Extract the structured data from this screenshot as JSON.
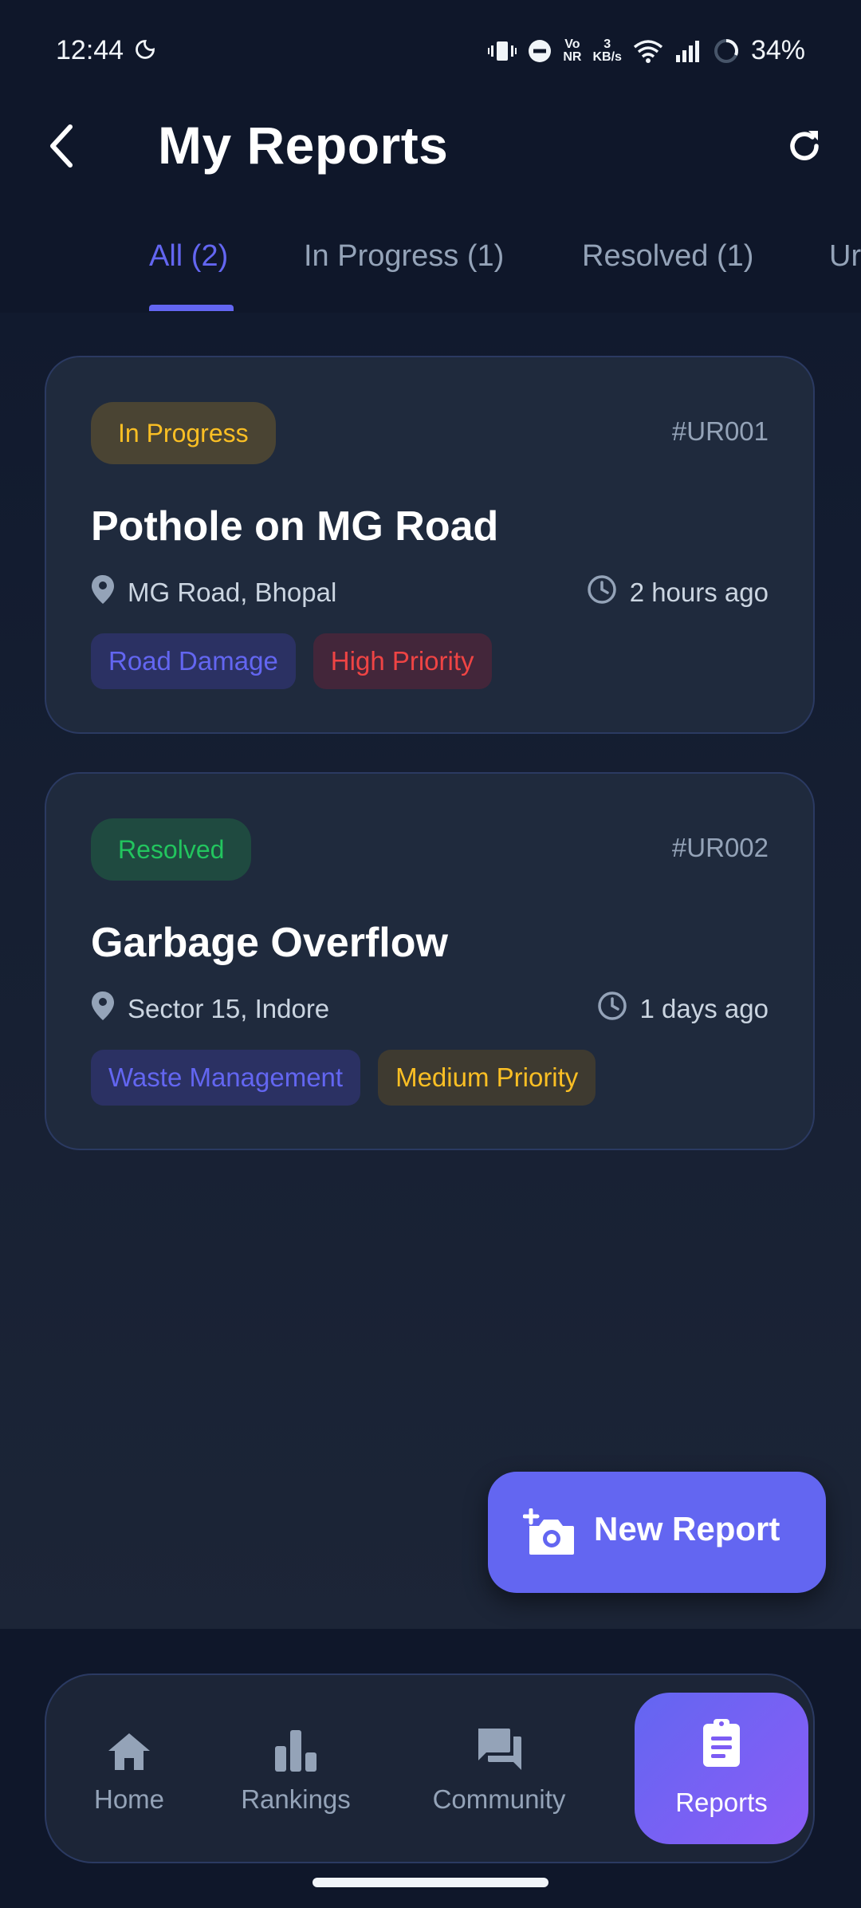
{
  "status_bar": {
    "time": "12:44",
    "net_top": "Vo",
    "net_bottom": "NR",
    "speed_top": "3",
    "speed_bottom": "KB/s",
    "battery": "34%"
  },
  "app_bar": {
    "title": "My Reports"
  },
  "tabs": [
    {
      "label": "All (2)",
      "active": true
    },
    {
      "label": "In Progress (1)",
      "active": false
    },
    {
      "label": "Resolved (1)",
      "active": false
    },
    {
      "label": "Ur",
      "active": false
    }
  ],
  "reports": [
    {
      "status": "In Progress",
      "id": "#UR001",
      "title": "Pothole on MG Road",
      "location": "MG Road, Bhopal",
      "time": "2 hours ago",
      "tags": [
        "Road Damage",
        "High Priority"
      ]
    },
    {
      "status": "Resolved",
      "id": "#UR002",
      "title": "Garbage Overflow",
      "location": "Sector 15, Indore",
      "time": "1 days ago",
      "tags": [
        "Waste Management",
        "Medium Priority"
      ]
    }
  ],
  "fab": {
    "label": "New Report",
    "icon": "add-camera-icon"
  },
  "bottom_nav": [
    {
      "label": "Home",
      "icon": "home-icon",
      "active": false
    },
    {
      "label": "Rankings",
      "icon": "bar-chart-icon",
      "active": false
    },
    {
      "label": "Community",
      "icon": "chat-bubbles-icon",
      "active": false
    },
    {
      "label": "Reports",
      "icon": "clipboard-icon",
      "active": true
    }
  ],
  "colors": {
    "accent": "#6366f1",
    "background": "#0f172a",
    "card": "#1f2a3d",
    "in_progress": "#fbbf24",
    "resolved": "#22c55e",
    "high_priority": "#ef4444"
  }
}
